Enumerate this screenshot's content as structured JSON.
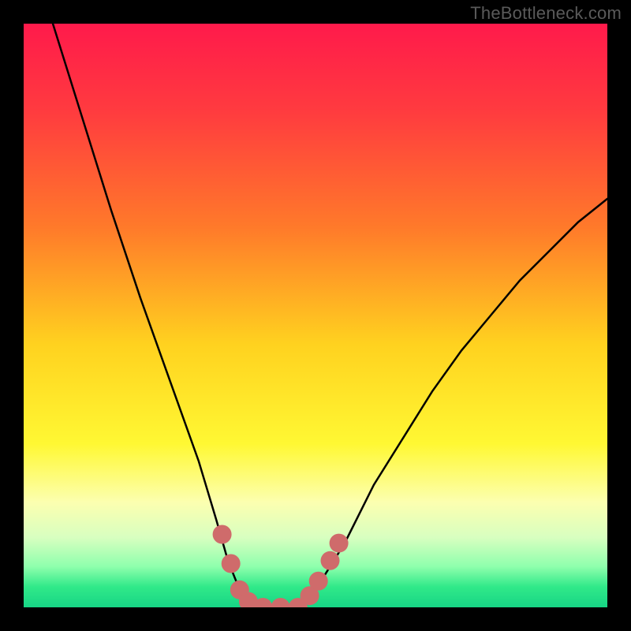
{
  "watermark": "TheBottleneck.com",
  "chart_data": {
    "type": "line",
    "title": "",
    "xlabel": "",
    "ylabel": "",
    "xlim": [
      0,
      100
    ],
    "ylim": [
      0,
      100
    ],
    "series": [
      {
        "name": "bottleneck-curve",
        "x": [
          5,
          10,
          15,
          20,
          25,
          30,
          33,
          35,
          37,
          40,
          44,
          47,
          50,
          55,
          60,
          65,
          70,
          75,
          80,
          85,
          90,
          95,
          100
        ],
        "values": [
          100,
          84,
          68,
          53,
          39,
          25,
          15,
          8,
          3,
          0,
          0,
          0,
          3,
          11,
          21,
          29,
          37,
          44,
          50,
          56,
          61,
          66,
          70
        ]
      }
    ],
    "markers": {
      "name": "highlight-dots",
      "color": "#cf6b6b",
      "points": [
        {
          "x": 34,
          "y": 12.5
        },
        {
          "x": 35.5,
          "y": 7.5
        },
        {
          "x": 37,
          "y": 3
        },
        {
          "x": 38.5,
          "y": 1
        },
        {
          "x": 41,
          "y": 0
        },
        {
          "x": 44,
          "y": 0
        },
        {
          "x": 47,
          "y": 0
        },
        {
          "x": 49,
          "y": 2
        },
        {
          "x": 50.5,
          "y": 4.5
        },
        {
          "x": 52.5,
          "y": 8
        },
        {
          "x": 54,
          "y": 11
        }
      ]
    },
    "gradient_stops": [
      {
        "offset": 0.0,
        "color": "#ff1a4b"
      },
      {
        "offset": 0.15,
        "color": "#ff3b3f"
      },
      {
        "offset": 0.35,
        "color": "#ff7a2a"
      },
      {
        "offset": 0.55,
        "color": "#ffd21f"
      },
      {
        "offset": 0.72,
        "color": "#fff833"
      },
      {
        "offset": 0.82,
        "color": "#fcffb0"
      },
      {
        "offset": 0.88,
        "color": "#d8ffc0"
      },
      {
        "offset": 0.93,
        "color": "#8fffad"
      },
      {
        "offset": 0.965,
        "color": "#30e989"
      },
      {
        "offset": 1.0,
        "color": "#17d585"
      }
    ]
  }
}
